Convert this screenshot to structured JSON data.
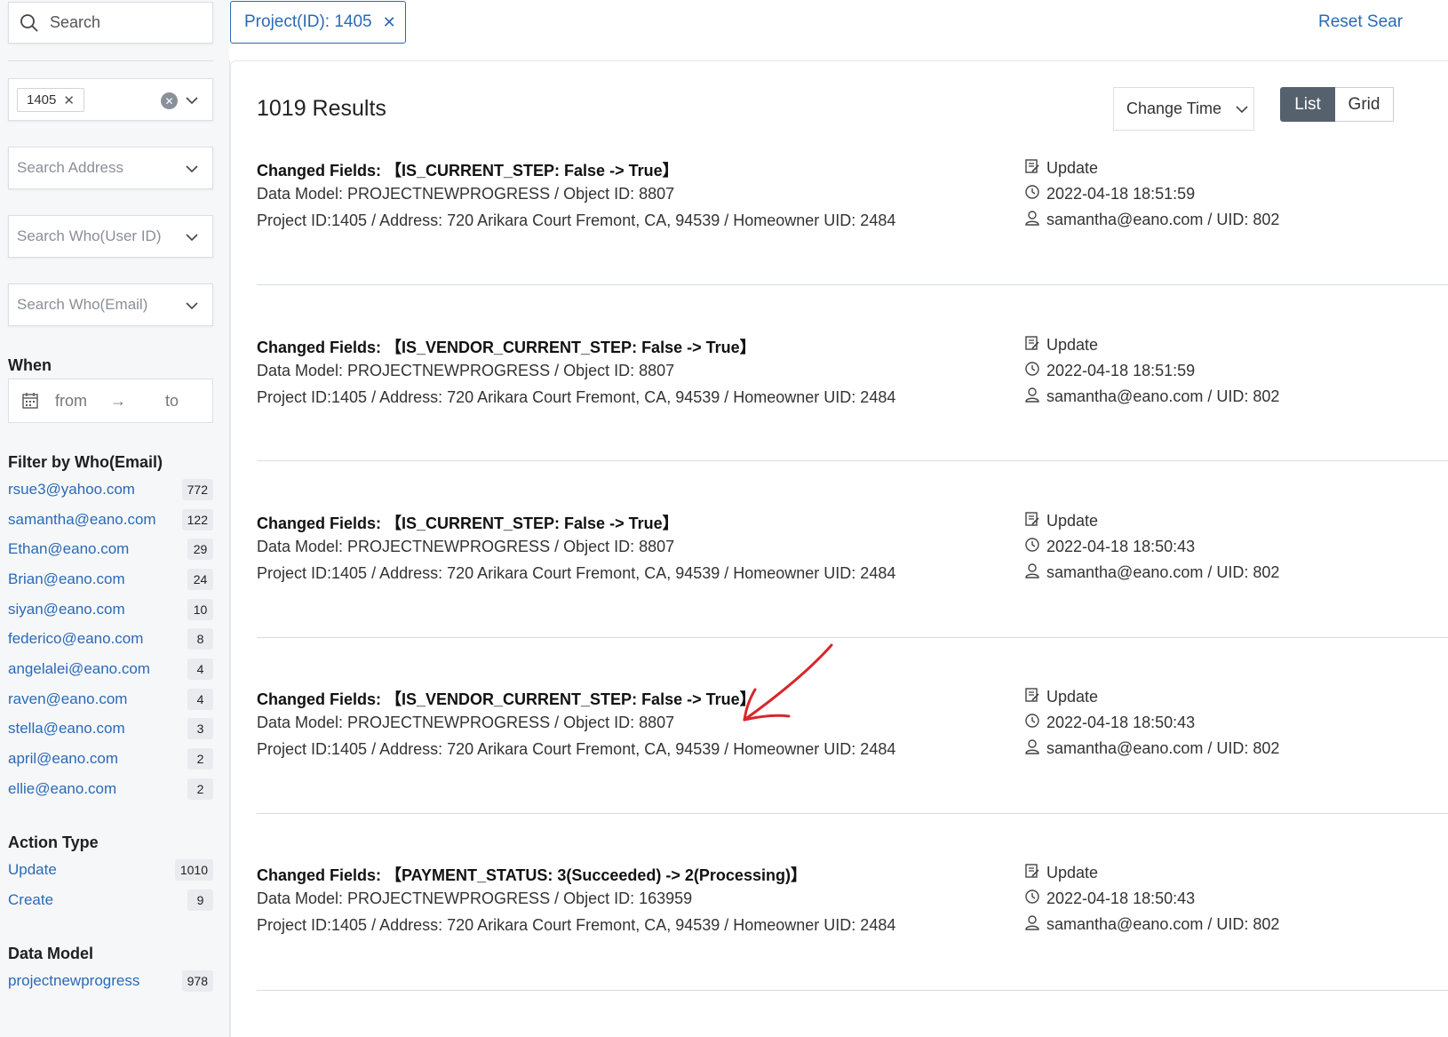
{
  "search": {
    "placeholder": "Search"
  },
  "active_filter": {
    "label": "Project(ID): 1405"
  },
  "reset_label": "Reset Sear",
  "sidebar": {
    "project_tag": "1405",
    "address_placeholder": "Search Address",
    "who_user_placeholder": "Search Who(User ID)",
    "who_email_placeholder": "Search Who(Email)",
    "when_title": "When",
    "date_from": "from",
    "date_arrow": "→",
    "date_to": "to",
    "email_filter_title": "Filter by Who(Email)",
    "emails": [
      {
        "label": "rsue3@yahoo.com",
        "count": "772"
      },
      {
        "label": "samantha@eano.com",
        "count": "122"
      },
      {
        "label": "Ethan@eano.com",
        "count": "29"
      },
      {
        "label": "Brian@eano.com",
        "count": "24"
      },
      {
        "label": "siyan@eano.com",
        "count": "10"
      },
      {
        "label": "federico@eano.com",
        "count": "8"
      },
      {
        "label": "angelalei@eano.com",
        "count": "4"
      },
      {
        "label": "raven@eano.com",
        "count": "4"
      },
      {
        "label": "stella@eano.com",
        "count": "3"
      },
      {
        "label": "april@eano.com",
        "count": "2"
      },
      {
        "label": "ellie@eano.com",
        "count": "2"
      }
    ],
    "action_title": "Action Type",
    "actions": [
      {
        "label": "Update",
        "count": "1010"
      },
      {
        "label": "Create",
        "count": "9"
      }
    ],
    "model_title": "Data Model",
    "models": [
      {
        "label": "projectnewprogress",
        "count": "978"
      }
    ]
  },
  "results_header": {
    "count_text": "1019 Results",
    "sort_label": "Change Time",
    "view_list": "List",
    "view_grid": "Grid"
  },
  "results": [
    {
      "changed": "Changed Fields: 【IS_CURRENT_STEP: False -> True】",
      "model": "Data Model: PROJECTNEWPROGRESS / Object ID: 8807",
      "project": "Project ID:1405 / Address: 720 Arikara Court Fremont, CA, 94539 / Homeowner UID: 2484",
      "action": "Update",
      "time": "2022-04-18 18:51:59",
      "user": "samantha@eano.com / UID: 802"
    },
    {
      "changed": "Changed Fields: 【IS_VENDOR_CURRENT_STEP: False -> True】",
      "model": "Data Model: PROJECTNEWPROGRESS / Object ID: 8807",
      "project": "Project ID:1405 / Address: 720 Arikara Court Fremont, CA, 94539 / Homeowner UID: 2484",
      "action": "Update",
      "time": "2022-04-18 18:51:59",
      "user": "samantha@eano.com / UID: 802"
    },
    {
      "changed": "Changed Fields: 【IS_CURRENT_STEP: False -> True】",
      "model": "Data Model: PROJECTNEWPROGRESS / Object ID: 8807",
      "project": "Project ID:1405 / Address: 720 Arikara Court Fremont, CA, 94539 / Homeowner UID: 2484",
      "action": "Update",
      "time": "2022-04-18 18:50:43",
      "user": "samantha@eano.com / UID: 802"
    },
    {
      "changed": "Changed Fields: 【IS_VENDOR_CURRENT_STEP: False -> True】",
      "model": "Data Model: PROJECTNEWPROGRESS / Object ID: 8807",
      "project": "Project ID:1405 / Address: 720 Arikara Court Fremont, CA, 94539 / Homeowner UID: 2484",
      "action": "Update",
      "time": "2022-04-18 18:50:43",
      "user": "samantha@eano.com / UID: 802"
    },
    {
      "changed": "Changed Fields: 【PAYMENT_STATUS: 3(Succeeded) -> 2(Processing)】",
      "model": "Data Model: PROJECTNEWPROGRESS / Object ID: 163959",
      "project": "Project ID:1405 / Address: 720 Arikara Court Fremont, CA, 94539 / Homeowner UID: 2484",
      "action": "Update",
      "time": "2022-04-18 18:50:43",
      "user": "samantha@eano.com / UID: 802"
    }
  ],
  "colors": {
    "link": "#2a6ab6",
    "annotation": "#d9262b",
    "toggle_active": "#56616e"
  }
}
